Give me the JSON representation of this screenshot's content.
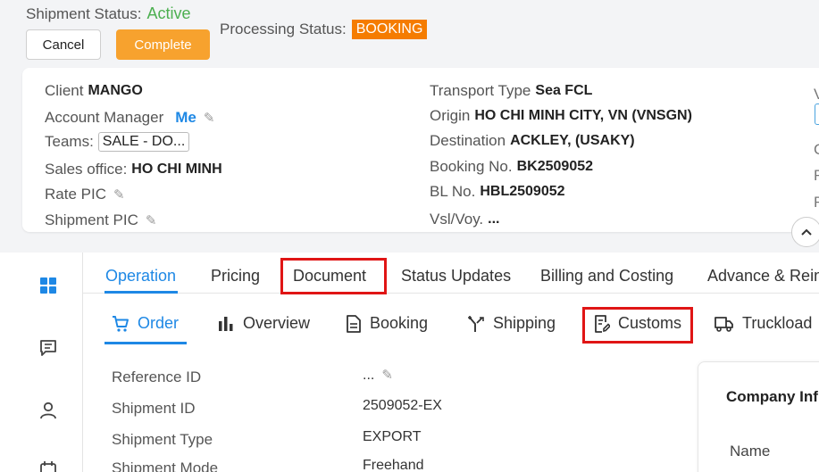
{
  "status": {
    "shipment_label": "Shipment Status:",
    "shipment_value": "Active",
    "processing_label": "Processing Status:",
    "processing_value": "BOOKING"
  },
  "actions": {
    "cancel": "Cancel",
    "complete": "Complete"
  },
  "info": {
    "left": [
      {
        "label": "Client",
        "value": "MANGO"
      },
      {
        "label": "Account Manager",
        "value": "Me"
      },
      {
        "label": "Teams:",
        "value": "SALE - DO..."
      },
      {
        "label": "Sales office:",
        "value": "HO CHI MINH"
      },
      {
        "label": "Rate PIC",
        "value": ""
      },
      {
        "label": "Shipment PIC",
        "value": ""
      }
    ],
    "right": [
      {
        "label": "Transport Type",
        "value": "Sea FCL"
      },
      {
        "label": "Origin",
        "value": "HO CHI MINH CITY, VN (VNSGN)"
      },
      {
        "label": "Destination",
        "value": "ACKLEY, (USAKY)"
      },
      {
        "label": "Booking No.",
        "value": "BK2509052"
      },
      {
        "label": "BL No.",
        "value": "HBL2509052"
      },
      {
        "label": "Vsl/Voy.",
        "value": "..."
      }
    ],
    "edge_fragments": [
      "V",
      "C",
      "F",
      "F"
    ]
  },
  "tabs": [
    "Operation",
    "Pricing",
    "Document",
    "Status Updates",
    "Billing and Costing",
    "Advance & Reim"
  ],
  "subtabs": [
    "Order",
    "Overview",
    "Booking",
    "Shipping",
    "Customs",
    "Truckload"
  ],
  "fields": [
    {
      "label": "Reference ID",
      "value": "..."
    },
    {
      "label": "Shipment ID",
      "value": "2509052-EX"
    },
    {
      "label": "Shipment Type",
      "value": "EXPORT"
    },
    {
      "label": "Shipment Mode",
      "value": "Freehand"
    }
  ],
  "company": {
    "title": "Company Inf",
    "name_label": "Name"
  },
  "colors": {
    "accent": "#1e88e5",
    "active": "#4caf50",
    "badge": "#f57c00",
    "complete": "#f7a22e",
    "highlight": "#e01515"
  }
}
